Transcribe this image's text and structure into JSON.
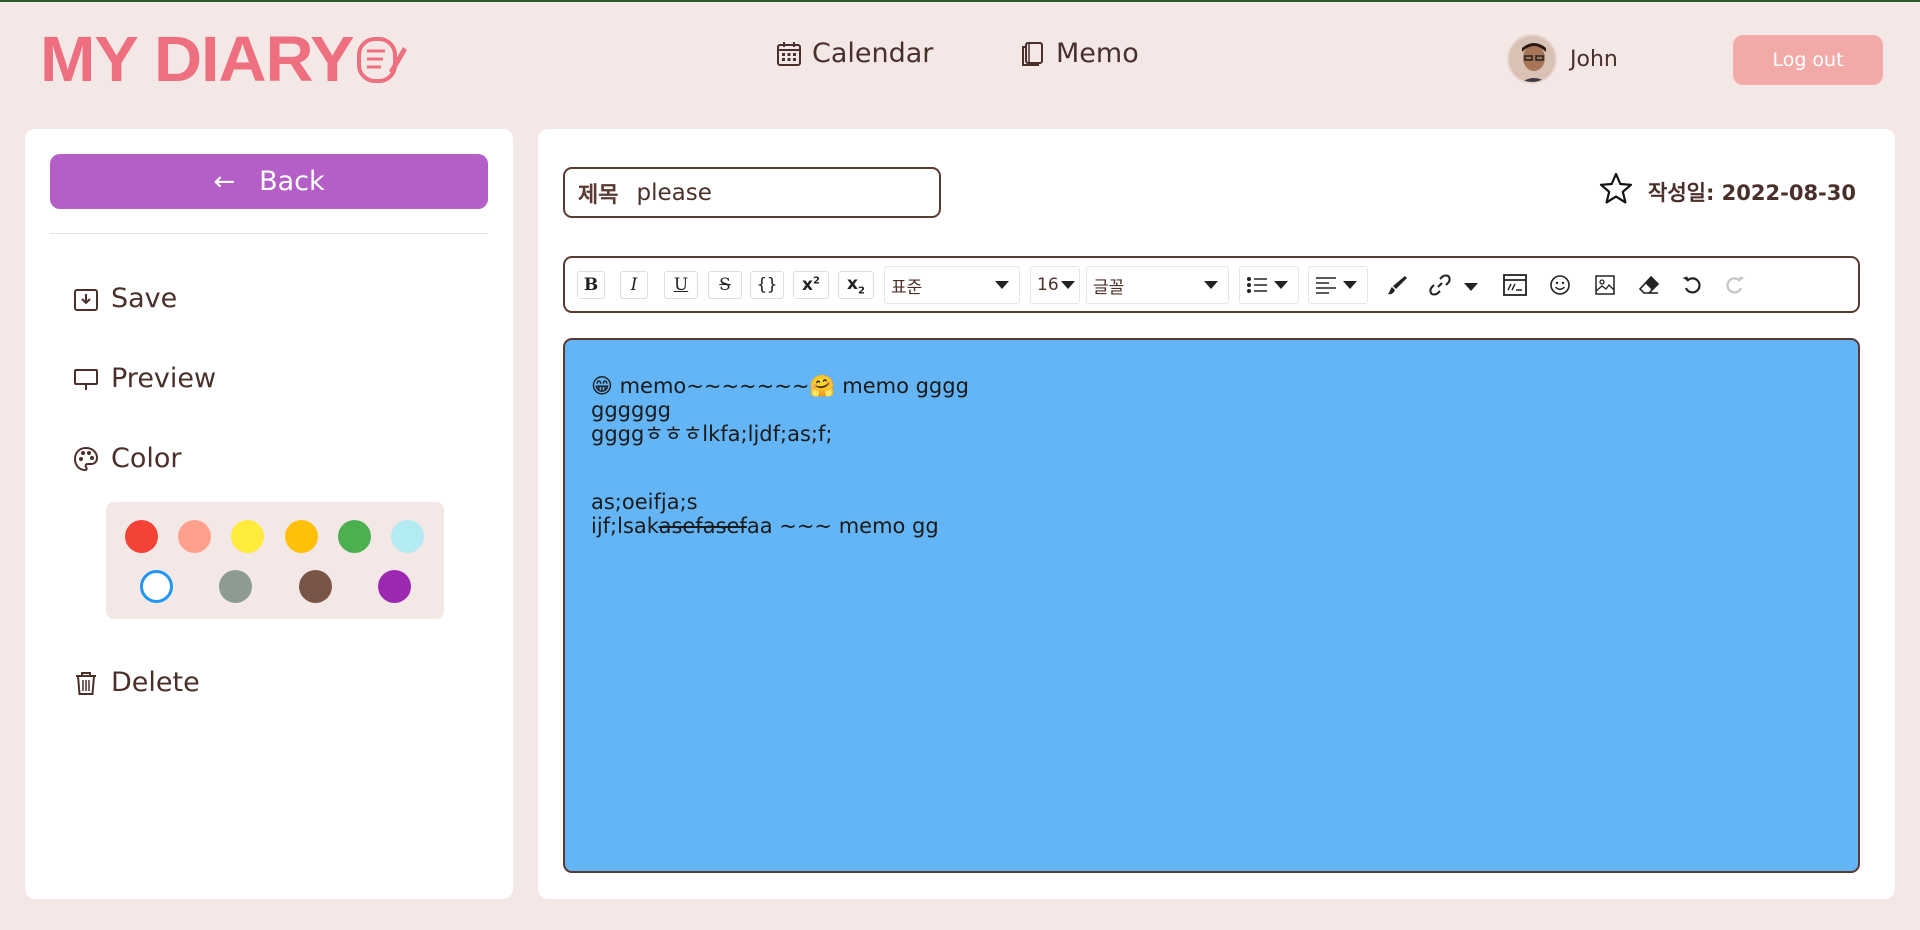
{
  "header": {
    "logo_text": "MY DIARY",
    "nav": [
      {
        "label": "Calendar",
        "icon": "calendar-icon"
      },
      {
        "label": "Memo",
        "icon": "notebook-icon"
      }
    ],
    "user": {
      "name": "John"
    },
    "logout_label": "Log out"
  },
  "sidebar": {
    "back_label": "Back",
    "items": [
      {
        "label": "Save",
        "icon": "save-icon"
      },
      {
        "label": "Preview",
        "icon": "preview-icon"
      },
      {
        "label": "Color",
        "icon": "palette-icon"
      },
      {
        "label": "Delete",
        "icon": "trash-icon"
      }
    ],
    "colors": [
      "#f44336",
      "#ffa08c",
      "#ffeb3b",
      "#ffc107",
      "#4caf50",
      "#b2ebf2",
      "#64b5f6",
      "#8d9b92",
      "#795548",
      "#9c27b0"
    ],
    "selected_color": "#64b5f6"
  },
  "editor": {
    "title_label": "제목",
    "title_value": "please",
    "date_text": "작성일: 2022-08-30",
    "toolbar": {
      "bold": "B",
      "italic": "I",
      "underline": "U",
      "strike": "S",
      "code": "{}",
      "format_value": "표준",
      "size_value": "16",
      "font_value": "글꼴"
    },
    "content": {
      "line1_a": "😁 memo~~~~~~~",
      "line1_b": "🤗 memo gggg",
      "line2": "gggggg",
      "line3": "ggggㅎㅎㅎlkfa;ljdf;as;f;",
      "line4": "",
      "line5": "as;oeifja;s",
      "line6_a": "ijf;lsak",
      "line6_strike": "asefasef",
      "line6_b": "aa ~~~ memo gg"
    }
  }
}
